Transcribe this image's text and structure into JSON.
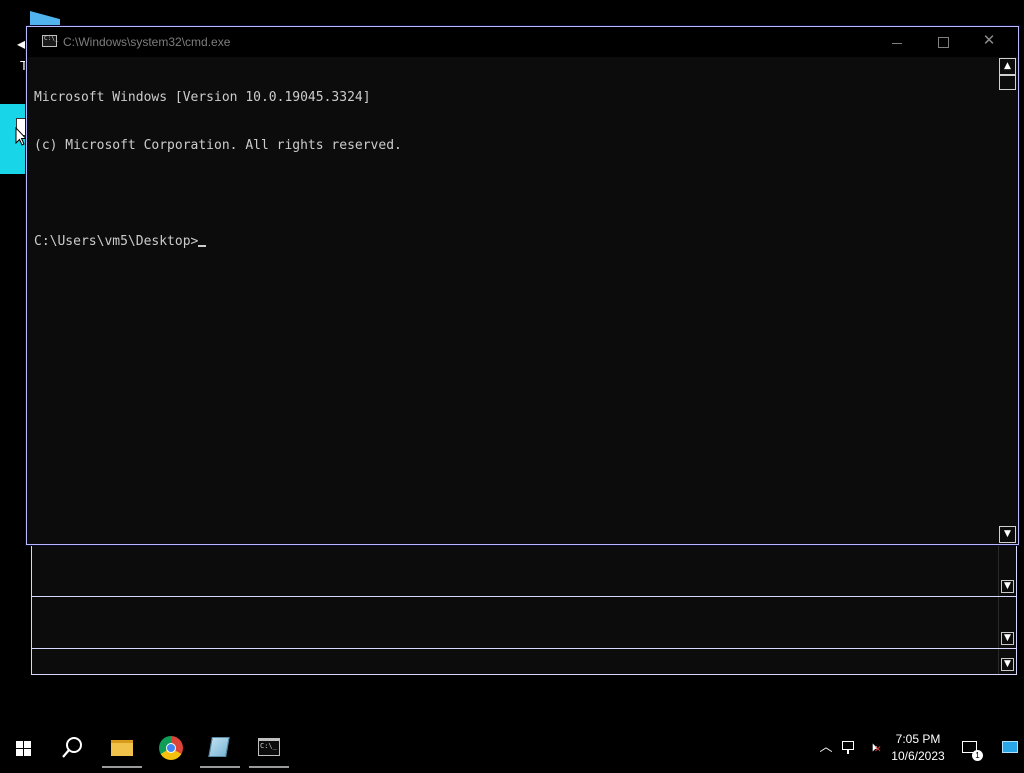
{
  "desktop": {
    "partial_label": "T"
  },
  "console": {
    "title": "C:\\Windows\\system32\\cmd.exe",
    "lines": [
      "Microsoft Windows [Version 10.0.19045.3324]",
      "(c) Microsoft Corporation. All rights reserved.",
      "",
      "C:\\Users\\vm5\\Desktop>"
    ]
  },
  "taskbar": {
    "icons": [
      "windows-start-icon",
      "search-icon",
      "file-explorer-icon",
      "chrome-icon",
      "snipping-tool-icon",
      "command-prompt-icon"
    ]
  },
  "tray": {
    "time": "7:05 PM",
    "date": "10/6/2023",
    "notification_count": "1",
    "volume_muted": true
  }
}
